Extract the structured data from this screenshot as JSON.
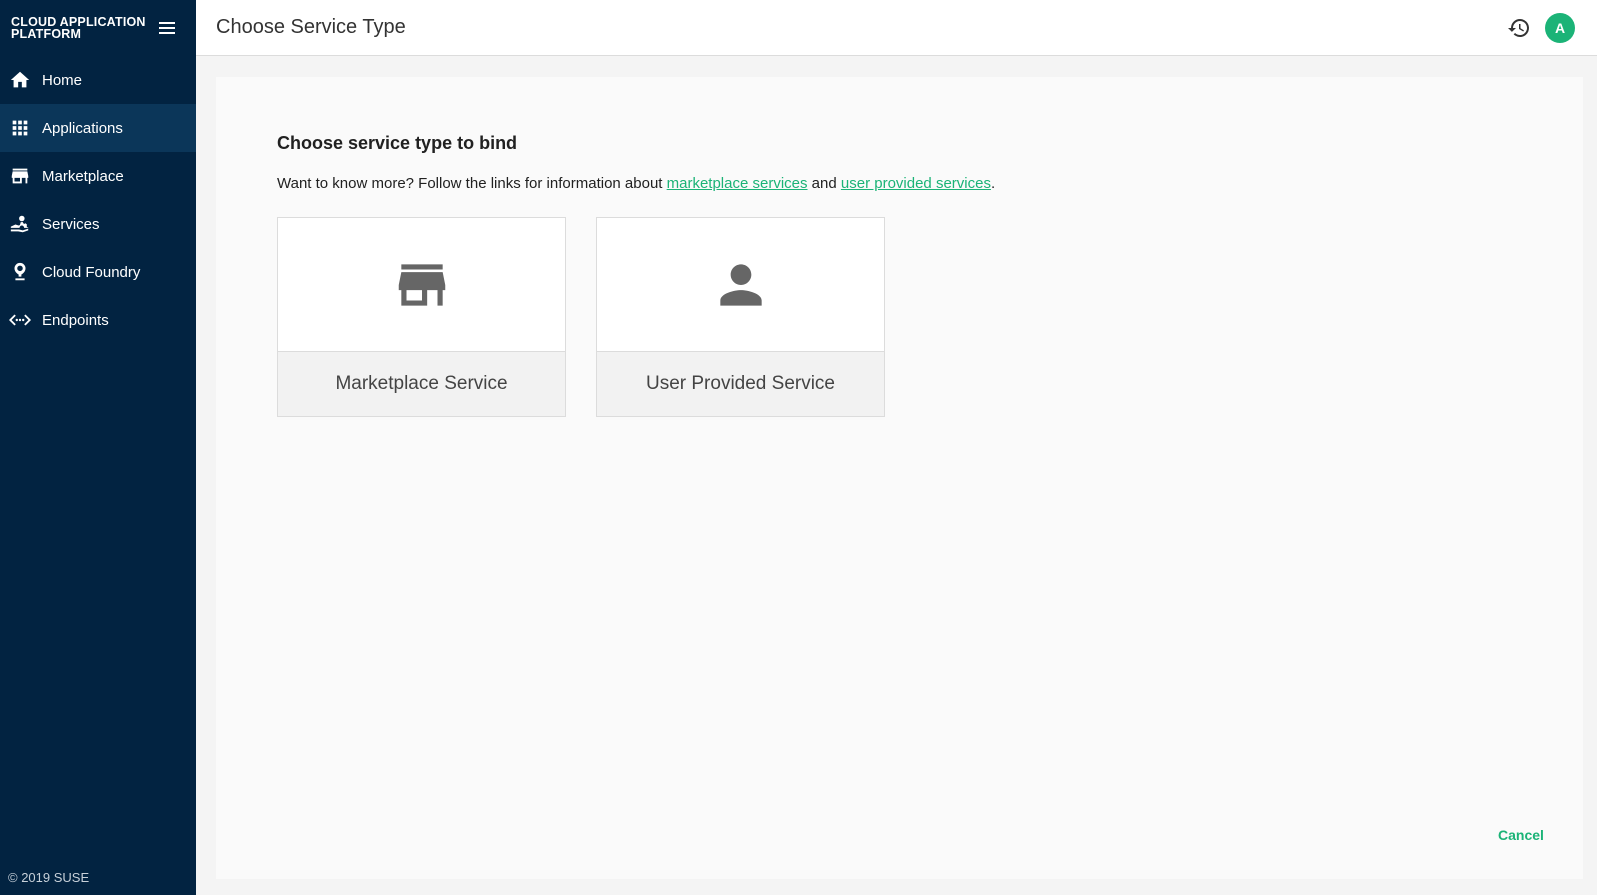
{
  "app": {
    "brand": "CLOUD APPLICATION PLATFORM",
    "footer": "© 2019 SUSE"
  },
  "sidebar": {
    "items": [
      {
        "label": "Home",
        "icon": "home-icon"
      },
      {
        "label": "Applications",
        "icon": "apps-grid-icon",
        "active": true
      },
      {
        "label": "Marketplace",
        "icon": "store-icon"
      },
      {
        "label": "Services",
        "icon": "services-hand-icon"
      },
      {
        "label": "Cloud Foundry",
        "icon": "cloud-foundry-icon"
      },
      {
        "label": "Endpoints",
        "icon": "endpoints-icon"
      }
    ]
  },
  "header": {
    "title": "Choose Service Type",
    "avatar_letter": "A"
  },
  "main": {
    "heading": "Choose service type to bind",
    "info_prefix": "Want to know more? Follow the links for information about ",
    "link_marketplace": "marketplace services",
    "info_and": " and ",
    "link_user_provided": "user provided services",
    "info_suffix": ".",
    "cards": [
      {
        "label": "Marketplace Service",
        "icon": "store-icon"
      },
      {
        "label": "User Provided Service",
        "icon": "person-icon"
      }
    ],
    "cancel_label": "Cancel"
  },
  "colors": {
    "sidebar_bg": "#022341",
    "sidebar_active": "#0b3659",
    "accent": "#1bb377"
  }
}
